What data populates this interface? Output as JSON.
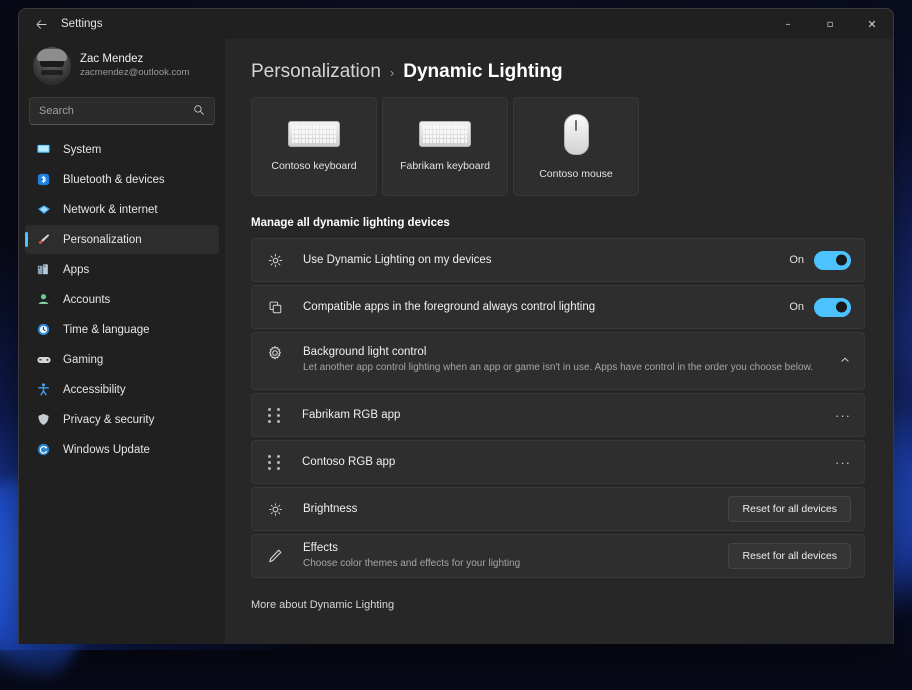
{
  "window": {
    "title": "Settings",
    "back_icon": "back-arrow-icon",
    "controls": {
      "minimize": "–",
      "maximize": "▫",
      "close": "✕"
    }
  },
  "sidebar": {
    "account": {
      "name": "Zac Mendez",
      "email": "zacmendez@outlook.com"
    },
    "search": {
      "placeholder": "Search",
      "value": "",
      "icon": "search-icon"
    },
    "items": [
      {
        "label": "System",
        "icon": "system-icon",
        "selected": false
      },
      {
        "label": "Bluetooth & devices",
        "icon": "bluetooth-icon",
        "selected": false
      },
      {
        "label": "Network & internet",
        "icon": "network-icon",
        "selected": false
      },
      {
        "label": "Personalization",
        "icon": "paintbrush-icon",
        "selected": true
      },
      {
        "label": "Apps",
        "icon": "apps-icon",
        "selected": false
      },
      {
        "label": "Accounts",
        "icon": "accounts-icon",
        "selected": false
      },
      {
        "label": "Time & language",
        "icon": "clock-icon",
        "selected": false
      },
      {
        "label": "Gaming",
        "icon": "gamepad-icon",
        "selected": false
      },
      {
        "label": "Accessibility",
        "icon": "accessibility-icon",
        "selected": false
      },
      {
        "label": "Privacy & security",
        "icon": "shield-icon",
        "selected": false
      },
      {
        "label": "Windows Update",
        "icon": "update-icon",
        "selected": false
      }
    ]
  },
  "main": {
    "breadcrumb": {
      "parent": "Personalization",
      "separator": "›",
      "current": "Dynamic Lighting"
    },
    "devices": [
      {
        "label": "Contoso keyboard",
        "art": "keyboard"
      },
      {
        "label": "Fabrikam keyboard",
        "art": "keyboard"
      },
      {
        "label": "Contoso mouse",
        "art": "mouse"
      }
    ],
    "section_header": "Manage all dynamic lighting devices",
    "toggles": [
      {
        "title": "Use Dynamic Lighting on my devices",
        "icon": "lighting-sparkle-icon",
        "state": "On"
      },
      {
        "title": "Compatible apps in the foreground always control lighting",
        "icon": "foreground-apps-icon",
        "state": "On"
      }
    ],
    "background_light_control": {
      "title": "Background light control",
      "subtitle": "Let another app control lighting when an app or game isn't in use. Apps have control in the order you choose below.",
      "icon": "gear-icon",
      "chevron": "∧"
    },
    "apps": [
      {
        "name": "Fabrikam RGB app",
        "menu": "···",
        "grip": "drag-handle-icon"
      },
      {
        "name": "Contoso RGB app",
        "menu": "···",
        "grip": "drag-handle-icon"
      }
    ],
    "brightness": {
      "title": "Brightness",
      "icon": "brightness-sun-icon",
      "button": "Reset for all devices"
    },
    "effects": {
      "title": "Effects",
      "subtitle": "Choose color themes and effects for your lighting",
      "icon": "pencil-effects-icon",
      "button": "Reset for all devices"
    },
    "more_link": "More about Dynamic Lighting"
  },
  "colors": {
    "accent": "#4cc2ff",
    "window_bg": "#202020",
    "content_bg": "#272727",
    "card_bg": "#2e2e2e"
  }
}
